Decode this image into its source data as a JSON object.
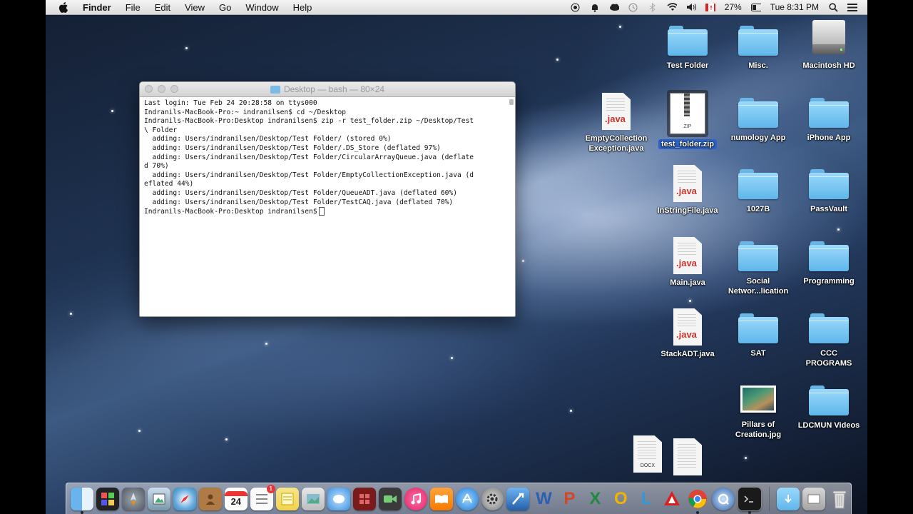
{
  "menubar": {
    "app_name": "Finder",
    "menus": [
      "File",
      "Edit",
      "View",
      "Go",
      "Window",
      "Help"
    ],
    "battery": "27%",
    "clock": "Tue 8:31 PM",
    "tray_icons": [
      "record-icon",
      "notification-icon",
      "cloud-icon",
      "time-machine-icon",
      "bluetooth-icon",
      "wifi-icon",
      "volume-icon",
      "canada-flag-icon",
      "battery-icon",
      "search-icon",
      "list-icon"
    ]
  },
  "terminal": {
    "title": "Desktop — bash — 80×24",
    "lines": [
      "Last login: Tue Feb 24 20:28:58 on ttys000",
      "Indranils-MacBook-Pro:~ indranilsen$ cd ~/Desktop",
      "Indranils-MacBook-Pro:Desktop indranilsen$ zip -r test_folder.zip ~/Desktop/Test",
      "\\ Folder",
      "  adding: Users/indranilsen/Desktop/Test Folder/ (stored 0%)",
      "  adding: Users/indranilsen/Desktop/Test Folder/.DS_Store (deflated 97%)",
      "  adding: Users/indranilsen/Desktop/Test Folder/CircularArrayQueue.java (deflate",
      "d 70%)",
      "  adding: Users/indranilsen/Desktop/Test Folder/EmptyCollectionException.java (d",
      "eflated 44%)",
      "  adding: Users/indranilsen/Desktop/Test Folder/QueueADT.java (deflated 60%)",
      "  adding: Users/indranilsen/Desktop/Test Folder/TestCAQ.java (deflated 70%)"
    ],
    "prompt": "Indranils-MacBook-Pro:Desktop indranilsen$"
  },
  "desktop": {
    "test_folder": "Test Folder",
    "misc": "Misc.",
    "macintosh_hd": "Macintosh HD",
    "empty_collection": "EmptyCollection\nException.java",
    "test_folder_zip": "test_folder.zip",
    "numology": "numology App",
    "iphone_app": "iPhone App",
    "instringfile": "InStringFile.java",
    "f1027b": "1027B",
    "passvault": "PassVault",
    "main_java": "Main.java",
    "social": "Social\nNetwor...lication",
    "programming": "Programming",
    "stackadt": "StackADT.java",
    "sat": "SAT",
    "ccc": "CCC\nPROGRAMS",
    "pillars": "Pillars of\nCreation.jpg",
    "ldcmun": "LDCMUN Videos",
    "java_tag": ".java",
    "docx_tag": "DOCX",
    "zip_tag": "ZIP"
  },
  "dock": {
    "calendar_day": "24",
    "badge_count": "1",
    "items": [
      "finder-icon",
      "dashboard-icon",
      "launchpad-icon",
      "preview-icon",
      "safari-icon",
      "contacts-icon",
      "calendar-icon",
      "reminders-icon",
      "notes-icon",
      "photos-icon",
      "messages-icon",
      "photo-booth-icon",
      "facetime-icon",
      "itunes-icon",
      "ibooks-icon",
      "app-store-icon",
      "system-preferences-icon",
      "xcode-icon",
      "word-icon",
      "powerpoint-icon",
      "excel-icon",
      "outlook-icon",
      "lync-icon",
      "acrobat-icon",
      "chrome-icon",
      "quicktime-icon",
      "terminal-icon",
      "downloads-icon",
      "documents-icon",
      "trash-icon"
    ],
    "letters": {
      "word": "W",
      "powerpoint": "P",
      "excel": "X",
      "outlook": "O",
      "lync": "L"
    }
  }
}
